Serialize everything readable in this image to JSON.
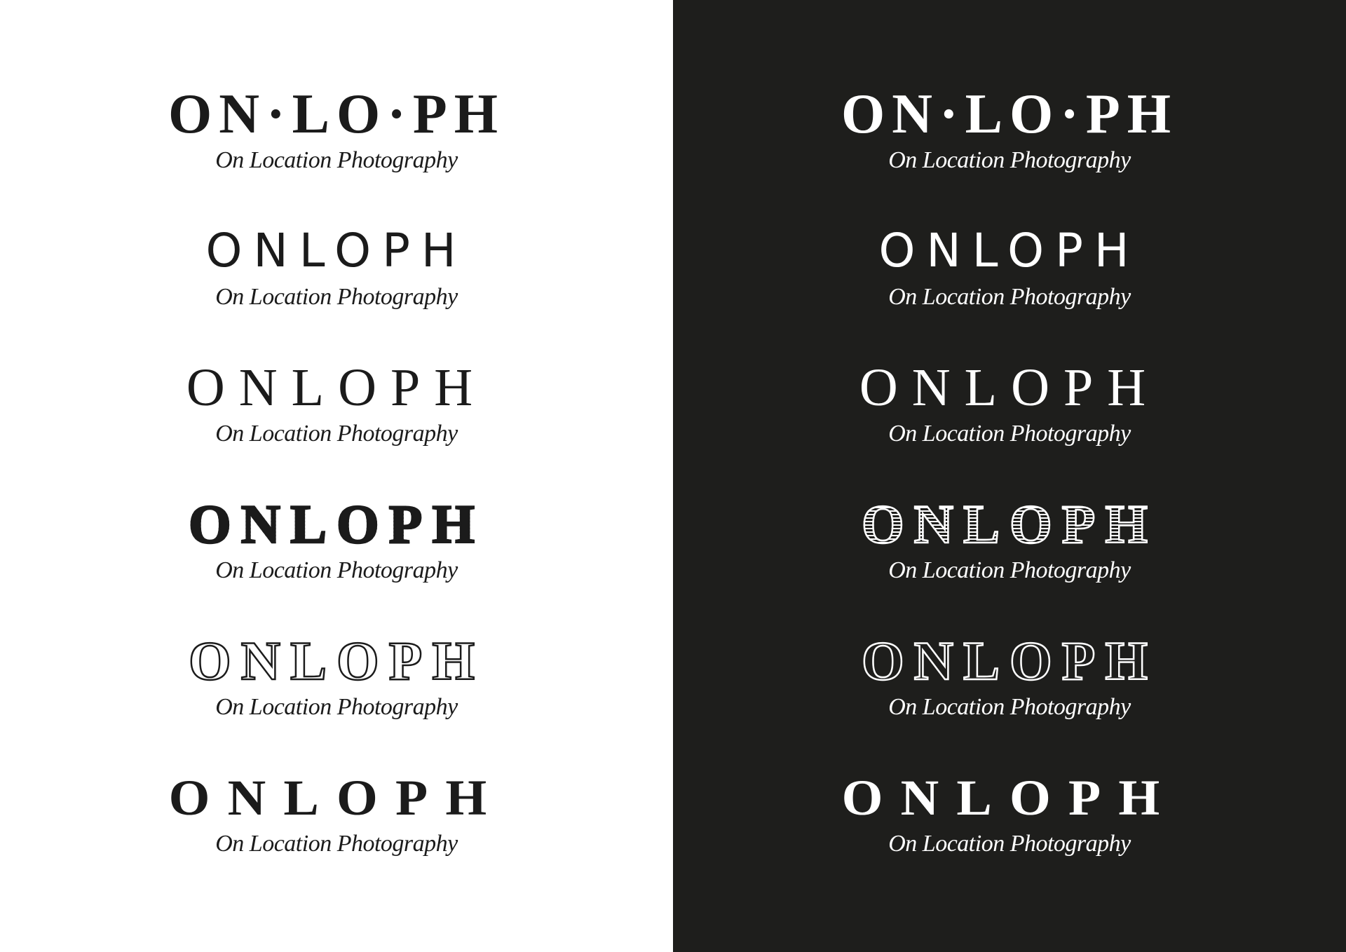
{
  "colors": {
    "light_bg": "#ffffff",
    "dark_bg": "#1e1e1c",
    "ink": "#1b1b1b",
    "paper": "#ffffff"
  },
  "logos": [
    {
      "wordmark": "ON·LO·PH",
      "tagline": "On Location Photography"
    },
    {
      "wordmark": "ONLOPH",
      "tagline": "On Location Photography"
    },
    {
      "wordmark": "ONLOPH",
      "tagline": "On Location Photography"
    },
    {
      "wordmark": "ONLOPH",
      "tagline": "On Location Photography"
    },
    {
      "wordmark": "ONLOPH",
      "tagline": "On Location Photography"
    },
    {
      "wordmark": "ONLOPH",
      "tagline": "On Location Photography"
    }
  ]
}
